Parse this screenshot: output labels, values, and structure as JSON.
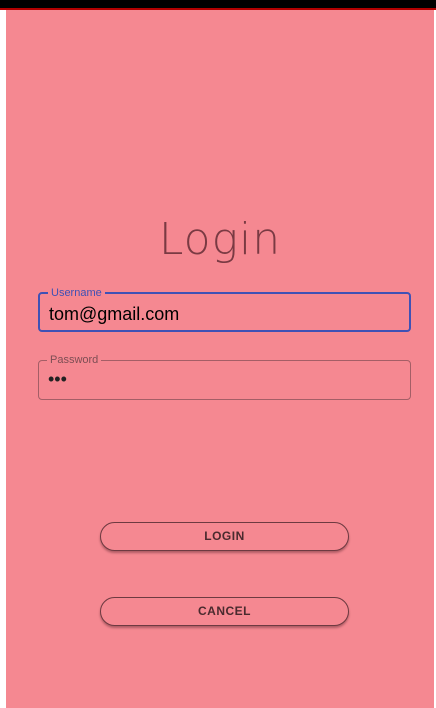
{
  "login_screen": {
    "title": "Login",
    "username": {
      "label": "Username",
      "value": "tom@gmail.com"
    },
    "password": {
      "label": "Password",
      "value": "•••"
    },
    "buttons": {
      "login_label": "LOGIN",
      "cancel_label": "CANCEL"
    }
  },
  "colors": {
    "background": "#f58891",
    "focused_accent": "#3f51b5",
    "title_text": "#7a3a43"
  }
}
